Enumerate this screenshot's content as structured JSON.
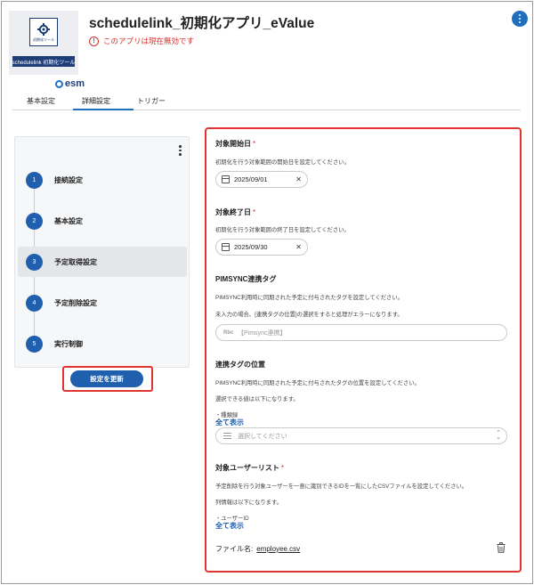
{
  "app": {
    "title": "schedulelink_初期化アプリ_eValue",
    "status": "このアプリは現在無効です",
    "logo_caption": "初期化ツール",
    "logo_banner": "schedulelink 初期化ツール",
    "brand": "esm"
  },
  "tabs": [
    {
      "label": "基本設定",
      "active": false
    },
    {
      "label": "詳細設定",
      "active": true
    },
    {
      "label": "トリガー",
      "active": false
    }
  ],
  "steps": [
    {
      "num": "1",
      "label": "接続設定",
      "active": false
    },
    {
      "num": "2",
      "label": "基本設定",
      "active": false
    },
    {
      "num": "3",
      "label": "予定取得設定",
      "active": true
    },
    {
      "num": "4",
      "label": "予定削除設定",
      "active": false
    },
    {
      "num": "5",
      "label": "実行制御",
      "active": false
    }
  ],
  "update_button": "設定を更新",
  "form": {
    "start_date": {
      "label": "対象開始日",
      "required": "*",
      "desc": "初期化を行う対象範囲の開始日を設定してください。",
      "value": "2025/09/01"
    },
    "end_date": {
      "label": "対象終了日",
      "required": "*",
      "desc": "初期化を行う対象範囲の終了日を設定してください。",
      "value": "2025/09/30"
    },
    "pimsync_tag": {
      "label": "PIMSYNC連携タグ",
      "desc1": "PIMSYNC利用時に同期された予定に付与されたタグを設定してください。",
      "desc2": "未入力の場合、[連携タグの位置]の選択をすると処理がエラーになります。",
      "placeholder": "【Pimsync連携】",
      "type_badge": "Rbc"
    },
    "tag_position": {
      "label": "連携タグの位置",
      "desc1": "PIMSYNC利用時に同期された予定に付与されたタグの位置を設定してください。",
      "desc2": "選択できる値は以下になります。",
      "note": "・種類録",
      "show_all": "全て表示",
      "placeholder": "選択してください"
    },
    "user_list": {
      "label": "対象ユーザーリスト",
      "required": "*",
      "desc1": "予定削除を行う対象ユーザーを一意に識別できるIDを一覧にしたCSVファイルを設定してください。",
      "desc2": "列情報は以下になります。",
      "note": "・ユーザーID",
      "show_all": "全て表示",
      "file_label": "ファイル名:",
      "file_name": "employee.csv"
    }
  },
  "colors": {
    "primary": "#1f5fae",
    "highlight": "#e0342e",
    "error": "#d0302c"
  }
}
